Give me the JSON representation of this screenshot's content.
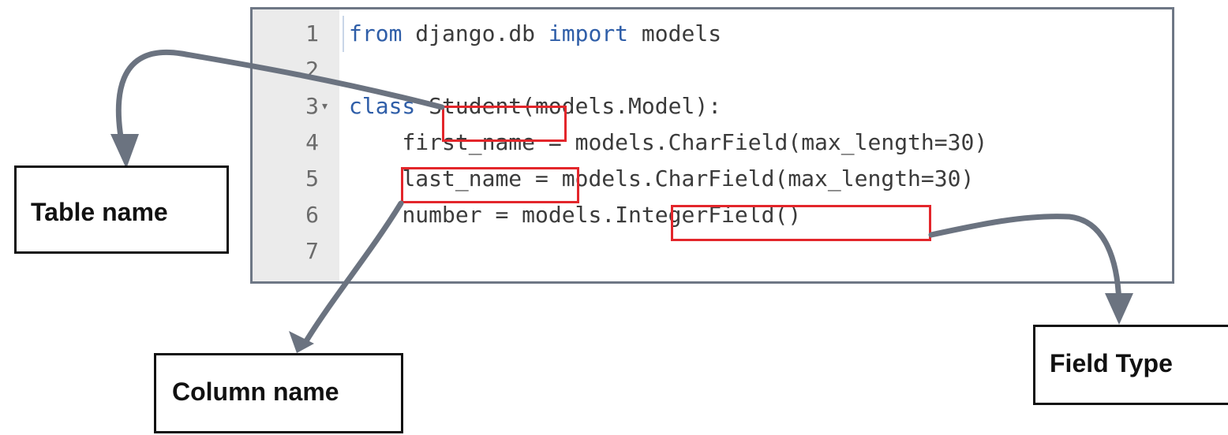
{
  "code_lines": [
    {
      "num": "1",
      "fold": "",
      "text": "from django.db import models"
    },
    {
      "num": "2",
      "fold": "",
      "text": ""
    },
    {
      "num": "3",
      "fold": "▾",
      "text": "class Student(models.Model):"
    },
    {
      "num": "4",
      "fold": "",
      "text": "    first_name = models.CharField(max_length=30)"
    },
    {
      "num": "5",
      "fold": "",
      "text": "    last_name = models.CharField(max_length=30)"
    },
    {
      "num": "6",
      "fold": "",
      "text": "    number = models.IntegerField()"
    },
    {
      "num": "7",
      "fold": "",
      "text": ""
    }
  ],
  "keywords": [
    "from",
    "import",
    "class"
  ],
  "labels": {
    "table": "Table name",
    "column": "Column name",
    "field": "Field Type"
  },
  "colors": {
    "highlight": "#e3262b",
    "arrow": "#6b7380",
    "keyword": "#2f5ea8"
  }
}
